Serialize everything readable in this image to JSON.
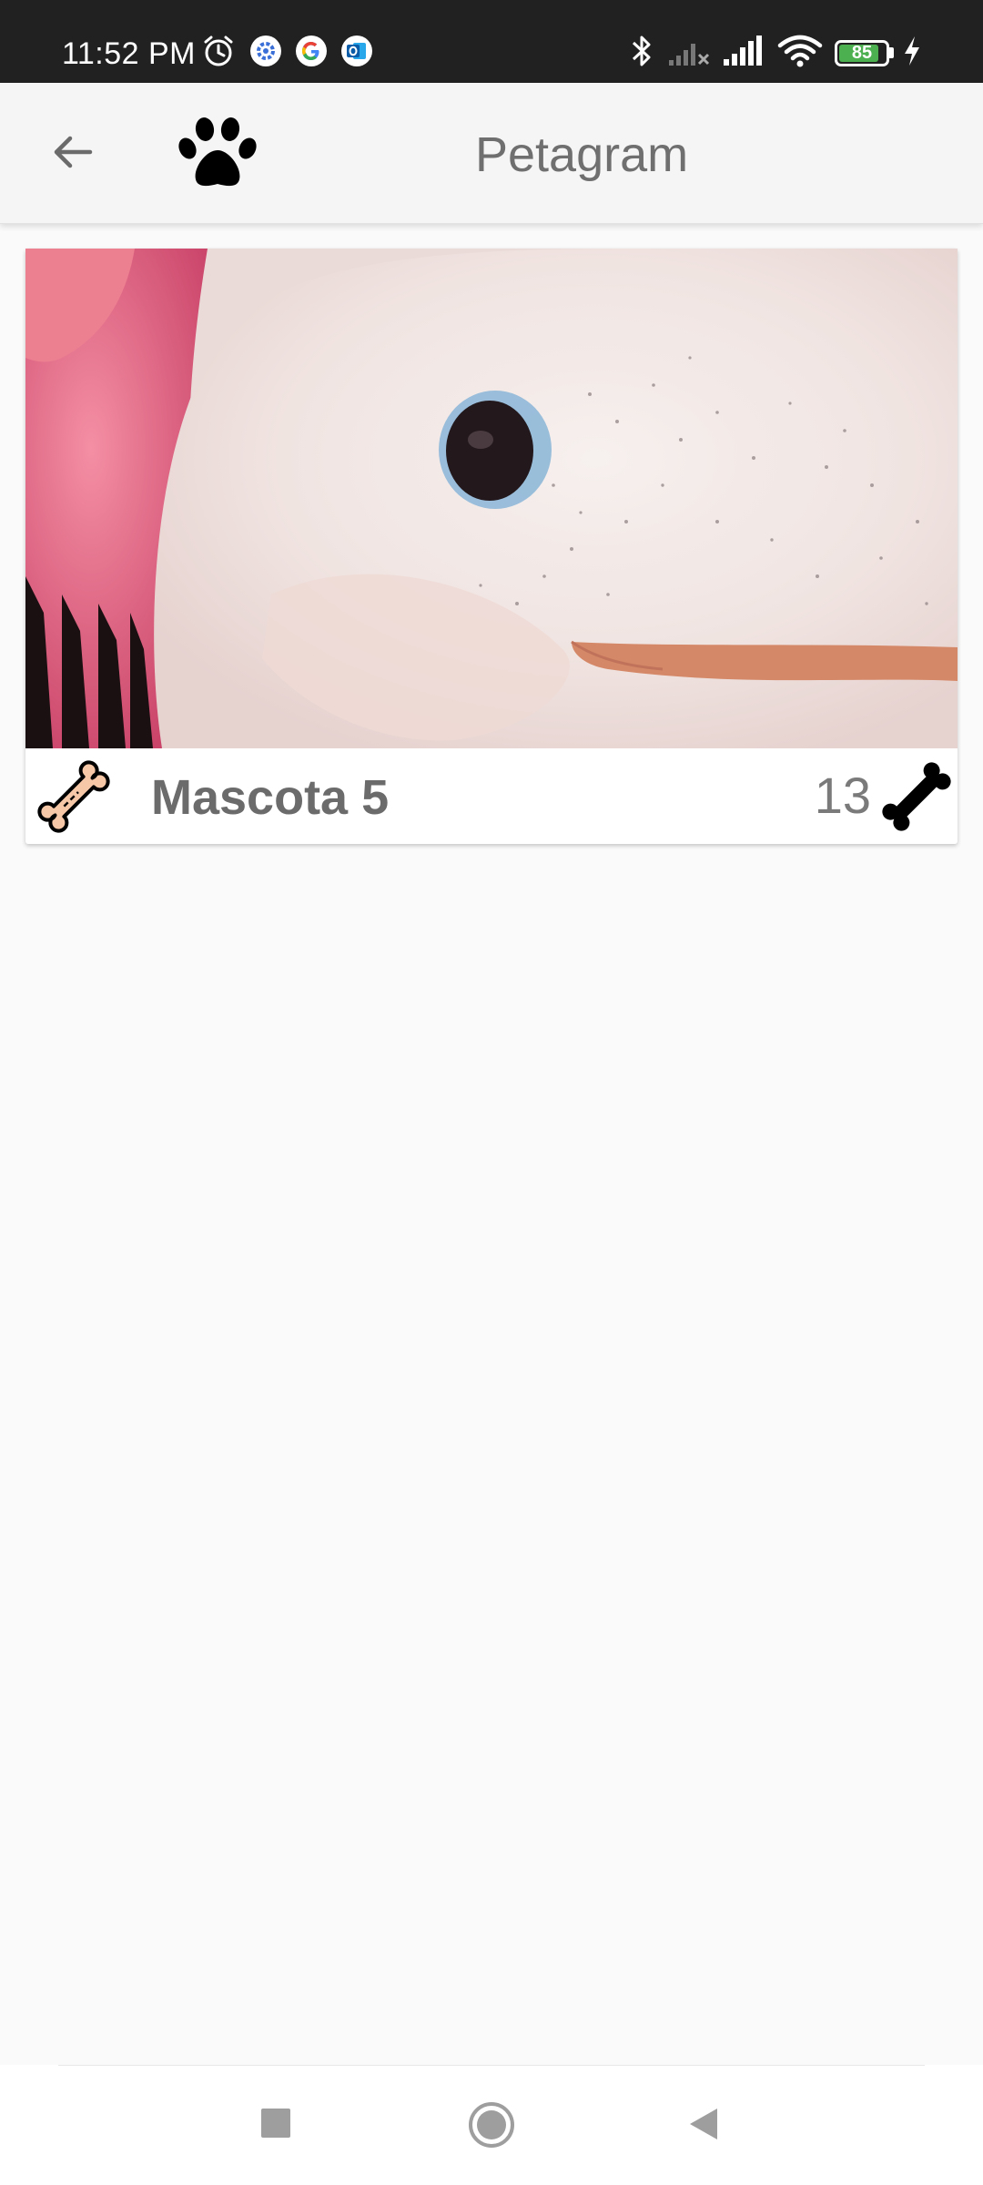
{
  "status_bar": {
    "time": "11:52 PM",
    "icons": [
      "alarm-icon",
      "settings-notification-icon",
      "google-icon",
      "outlook-icon",
      "bluetooth-icon",
      "no-signal-icon",
      "signal-icon",
      "wifi-icon",
      "battery-icon",
      "charging-icon"
    ],
    "battery_level": "85",
    "battery_fraction": 0.85,
    "battery_color": "#4caf50"
  },
  "app_bar": {
    "title": "Petagram",
    "back_icon": "arrow-back-icon",
    "logo_icon": "paw-icon"
  },
  "pets": [
    {
      "name": "Mascota 5",
      "likes": "13",
      "like_icon": "bone-outline-icon",
      "rating_icon": "bone-filled-icon"
    }
  ],
  "nav_bar": {
    "buttons": [
      "recents-square-icon",
      "home-circle-icon",
      "back-triangle-icon"
    ]
  },
  "colors": {
    "status_bar": "#212121",
    "app_bar": "#f5f5f5",
    "background": "#fafafa",
    "bone_fill": "#f6c8a8"
  }
}
